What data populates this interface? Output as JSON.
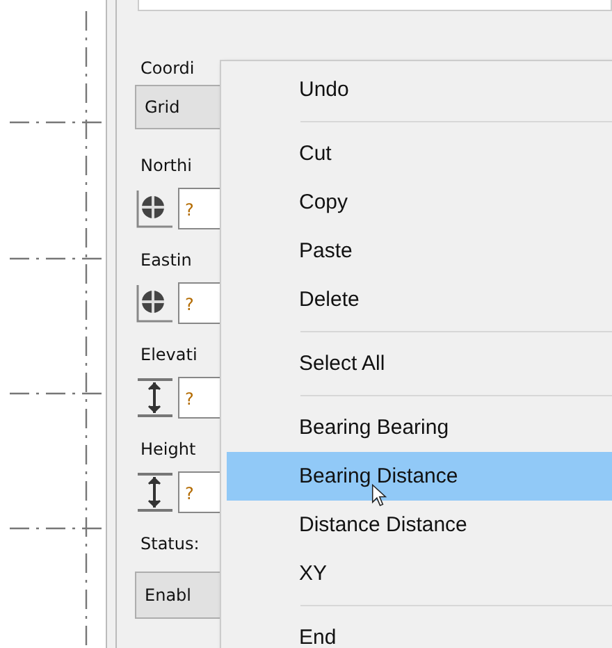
{
  "panel": [
    {
      "kind": "label",
      "text": "Coordi"
    },
    {
      "kind": "dropdown",
      "value": "Grid"
    },
    {
      "kind": "label",
      "text": "Northi"
    },
    {
      "kind": "target-field",
      "value": "?"
    },
    {
      "kind": "label",
      "text": "Eastin"
    },
    {
      "kind": "target-field",
      "value": "?"
    },
    {
      "kind": "label",
      "text": "Elevati"
    },
    {
      "kind": "height-field",
      "value": "?"
    },
    {
      "kind": "label",
      "text": "Height"
    },
    {
      "kind": "height-field",
      "value": "?"
    },
    {
      "kind": "label",
      "text": "Status:"
    },
    {
      "kind": "button",
      "text": "Enabl"
    }
  ],
  "context_menu": [
    {
      "kind": "item",
      "label": "Undo",
      "selected": false
    },
    {
      "kind": "separator"
    },
    {
      "kind": "item",
      "label": "Cut",
      "selected": false
    },
    {
      "kind": "item",
      "label": "Copy",
      "selected": false
    },
    {
      "kind": "item",
      "label": "Paste",
      "selected": false
    },
    {
      "kind": "item",
      "label": "Delete",
      "selected": false
    },
    {
      "kind": "separator"
    },
    {
      "kind": "item",
      "label": "Select All",
      "selected": false
    },
    {
      "kind": "separator"
    },
    {
      "kind": "item",
      "label": "Bearing Bearing",
      "selected": false
    },
    {
      "kind": "item",
      "label": "Bearing Distance",
      "selected": true
    },
    {
      "kind": "item",
      "label": "Distance Distance",
      "selected": false
    },
    {
      "kind": "item",
      "label": "XY",
      "selected": false
    },
    {
      "kind": "separator"
    },
    {
      "kind": "item",
      "label": "End",
      "selected": false
    }
  ]
}
